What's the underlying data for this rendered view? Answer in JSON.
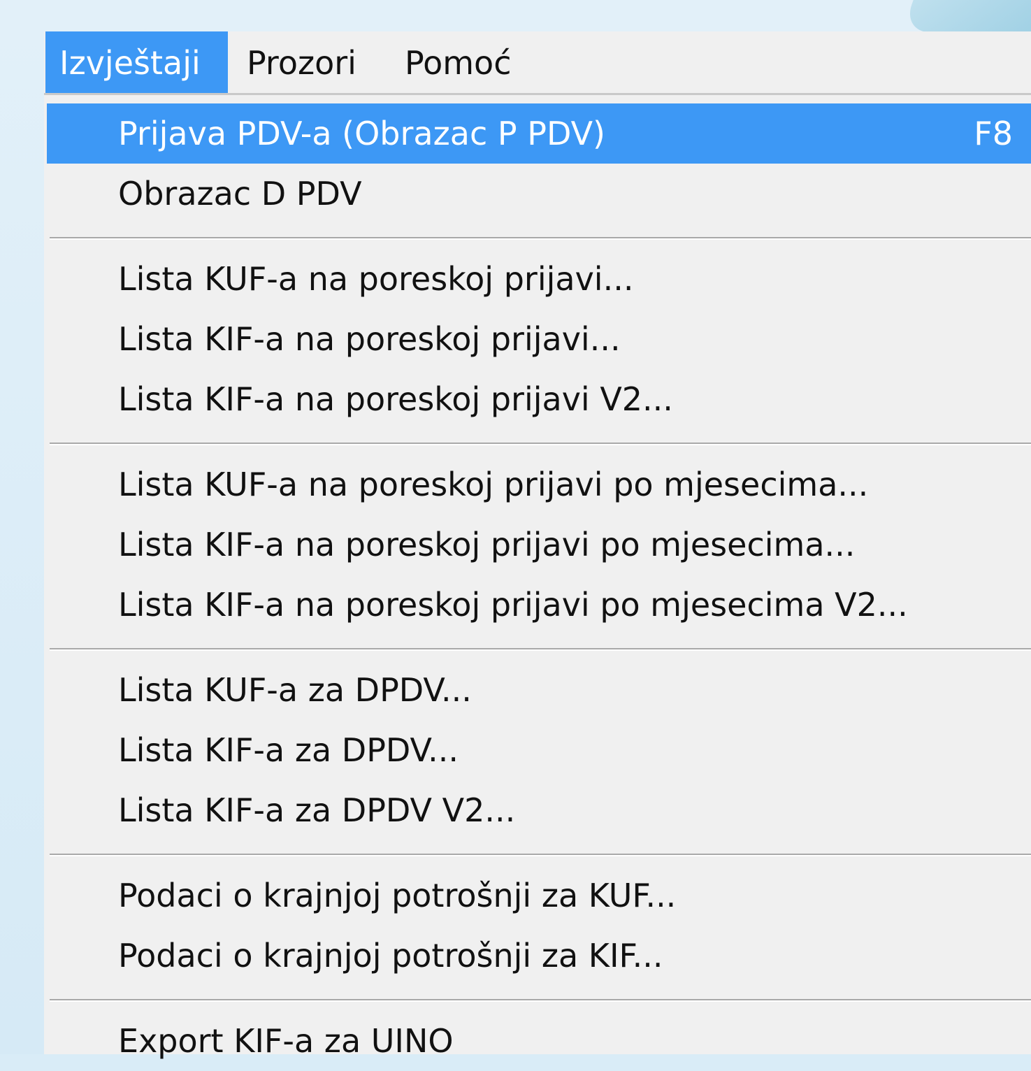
{
  "menubar": {
    "items": [
      {
        "label": "Izvještaji"
      },
      {
        "label": "Prozori"
      },
      {
        "label": "Pomoć"
      }
    ]
  },
  "dropdown": {
    "items": [
      {
        "label": "Prijava PDV-a (Obrazac P PDV)",
        "shortcut": "F8"
      },
      {
        "label": "Obrazac D PDV"
      },
      {
        "label": "Lista KUF-a na poreskoj prijavi..."
      },
      {
        "label": "Lista KIF-a na poreskoj prijavi..."
      },
      {
        "label": "Lista KIF-a na poreskoj prijavi V2..."
      },
      {
        "label": "Lista KUF-a na poreskoj prijavi po mjesecima..."
      },
      {
        "label": "Lista KIF-a na poreskoj prijavi po mjesecima..."
      },
      {
        "label": "Lista KIF-a na poreskoj prijavi po mjesecima V2..."
      },
      {
        "label": "Lista KUF-a za DPDV..."
      },
      {
        "label": "Lista KIF-a za DPDV..."
      },
      {
        "label": "Lista KIF-a za DPDV V2..."
      },
      {
        "label": "Podaci o krajnjoj potrošnji za KUF..."
      },
      {
        "label": "Podaci o krajnjoj potrošnji za KIF..."
      },
      {
        "label": "Export KIF-a za UINO"
      }
    ]
  },
  "colors": {
    "highlight": "#3d98f5",
    "menu_bg": "#f0f0f0",
    "desktop_bg": "#d9ecf7"
  }
}
